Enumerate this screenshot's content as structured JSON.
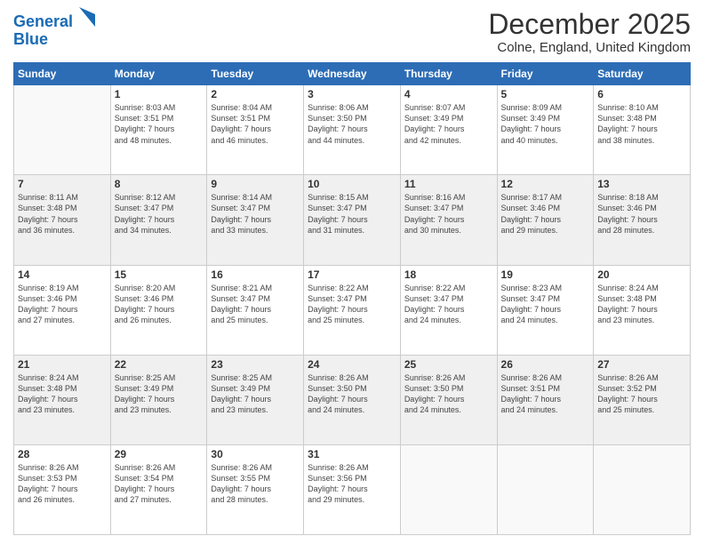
{
  "header": {
    "logo_line1": "General",
    "logo_line2": "Blue",
    "title": "December 2025",
    "subtitle": "Colne, England, United Kingdom"
  },
  "days_of_week": [
    "Sunday",
    "Monday",
    "Tuesday",
    "Wednesday",
    "Thursday",
    "Friday",
    "Saturday"
  ],
  "weeks": [
    [
      {
        "day": "",
        "info": ""
      },
      {
        "day": "1",
        "info": "Sunrise: 8:03 AM\nSunset: 3:51 PM\nDaylight: 7 hours\nand 48 minutes."
      },
      {
        "day": "2",
        "info": "Sunrise: 8:04 AM\nSunset: 3:51 PM\nDaylight: 7 hours\nand 46 minutes."
      },
      {
        "day": "3",
        "info": "Sunrise: 8:06 AM\nSunset: 3:50 PM\nDaylight: 7 hours\nand 44 minutes."
      },
      {
        "day": "4",
        "info": "Sunrise: 8:07 AM\nSunset: 3:49 PM\nDaylight: 7 hours\nand 42 minutes."
      },
      {
        "day": "5",
        "info": "Sunrise: 8:09 AM\nSunset: 3:49 PM\nDaylight: 7 hours\nand 40 minutes."
      },
      {
        "day": "6",
        "info": "Sunrise: 8:10 AM\nSunset: 3:48 PM\nDaylight: 7 hours\nand 38 minutes."
      }
    ],
    [
      {
        "day": "7",
        "info": "Sunrise: 8:11 AM\nSunset: 3:48 PM\nDaylight: 7 hours\nand 36 minutes."
      },
      {
        "day": "8",
        "info": "Sunrise: 8:12 AM\nSunset: 3:47 PM\nDaylight: 7 hours\nand 34 minutes."
      },
      {
        "day": "9",
        "info": "Sunrise: 8:14 AM\nSunset: 3:47 PM\nDaylight: 7 hours\nand 33 minutes."
      },
      {
        "day": "10",
        "info": "Sunrise: 8:15 AM\nSunset: 3:47 PM\nDaylight: 7 hours\nand 31 minutes."
      },
      {
        "day": "11",
        "info": "Sunrise: 8:16 AM\nSunset: 3:47 PM\nDaylight: 7 hours\nand 30 minutes."
      },
      {
        "day": "12",
        "info": "Sunrise: 8:17 AM\nSunset: 3:46 PM\nDaylight: 7 hours\nand 29 minutes."
      },
      {
        "day": "13",
        "info": "Sunrise: 8:18 AM\nSunset: 3:46 PM\nDaylight: 7 hours\nand 28 minutes."
      }
    ],
    [
      {
        "day": "14",
        "info": "Sunrise: 8:19 AM\nSunset: 3:46 PM\nDaylight: 7 hours\nand 27 minutes."
      },
      {
        "day": "15",
        "info": "Sunrise: 8:20 AM\nSunset: 3:46 PM\nDaylight: 7 hours\nand 26 minutes."
      },
      {
        "day": "16",
        "info": "Sunrise: 8:21 AM\nSunset: 3:47 PM\nDaylight: 7 hours\nand 25 minutes."
      },
      {
        "day": "17",
        "info": "Sunrise: 8:22 AM\nSunset: 3:47 PM\nDaylight: 7 hours\nand 25 minutes."
      },
      {
        "day": "18",
        "info": "Sunrise: 8:22 AM\nSunset: 3:47 PM\nDaylight: 7 hours\nand 24 minutes."
      },
      {
        "day": "19",
        "info": "Sunrise: 8:23 AM\nSunset: 3:47 PM\nDaylight: 7 hours\nand 24 minutes."
      },
      {
        "day": "20",
        "info": "Sunrise: 8:24 AM\nSunset: 3:48 PM\nDaylight: 7 hours\nand 23 minutes."
      }
    ],
    [
      {
        "day": "21",
        "info": "Sunrise: 8:24 AM\nSunset: 3:48 PM\nDaylight: 7 hours\nand 23 minutes."
      },
      {
        "day": "22",
        "info": "Sunrise: 8:25 AM\nSunset: 3:49 PM\nDaylight: 7 hours\nand 23 minutes."
      },
      {
        "day": "23",
        "info": "Sunrise: 8:25 AM\nSunset: 3:49 PM\nDaylight: 7 hours\nand 23 minutes."
      },
      {
        "day": "24",
        "info": "Sunrise: 8:26 AM\nSunset: 3:50 PM\nDaylight: 7 hours\nand 24 minutes."
      },
      {
        "day": "25",
        "info": "Sunrise: 8:26 AM\nSunset: 3:50 PM\nDaylight: 7 hours\nand 24 minutes."
      },
      {
        "day": "26",
        "info": "Sunrise: 8:26 AM\nSunset: 3:51 PM\nDaylight: 7 hours\nand 24 minutes."
      },
      {
        "day": "27",
        "info": "Sunrise: 8:26 AM\nSunset: 3:52 PM\nDaylight: 7 hours\nand 25 minutes."
      }
    ],
    [
      {
        "day": "28",
        "info": "Sunrise: 8:26 AM\nSunset: 3:53 PM\nDaylight: 7 hours\nand 26 minutes."
      },
      {
        "day": "29",
        "info": "Sunrise: 8:26 AM\nSunset: 3:54 PM\nDaylight: 7 hours\nand 27 minutes."
      },
      {
        "day": "30",
        "info": "Sunrise: 8:26 AM\nSunset: 3:55 PM\nDaylight: 7 hours\nand 28 minutes."
      },
      {
        "day": "31",
        "info": "Sunrise: 8:26 AM\nSunset: 3:56 PM\nDaylight: 7 hours\nand 29 minutes."
      },
      {
        "day": "",
        "info": ""
      },
      {
        "day": "",
        "info": ""
      },
      {
        "day": "",
        "info": ""
      }
    ]
  ]
}
